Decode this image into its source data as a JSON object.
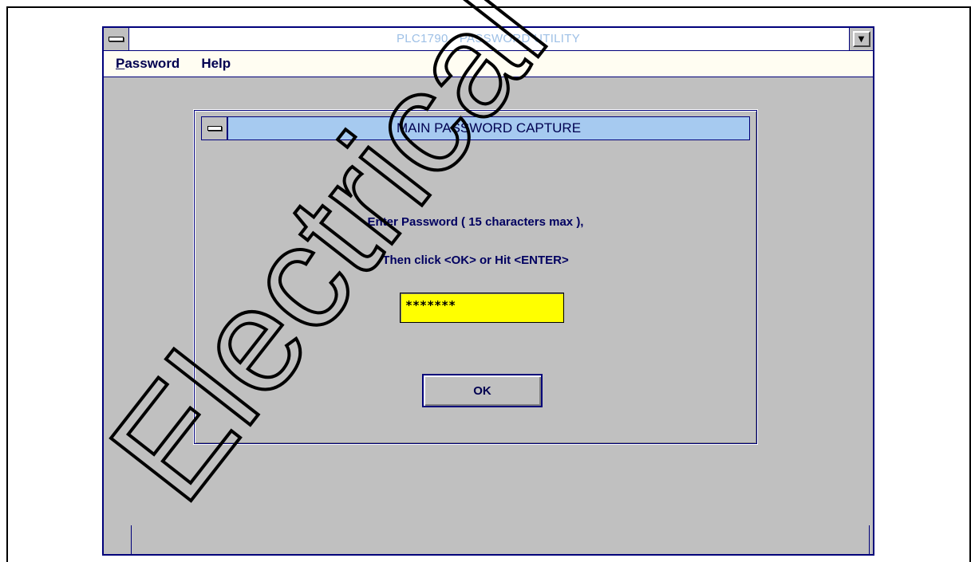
{
  "window": {
    "title": "PLC1790 - PASSWORD UTILITY"
  },
  "menu": {
    "items": [
      {
        "label": "assword",
        "accel": "P"
      },
      {
        "label": "Help",
        "accel": ""
      }
    ]
  },
  "dialog": {
    "title": "MAIN PASSWORD CAPTURE",
    "prompt_line1": "Enter Password ( 15 characters max ),",
    "prompt_line2": "Then click <OK> or Hit <ENTER>",
    "password_value": "*******",
    "ok_label": "OK"
  },
  "watermark": {
    "text": "Electrical"
  },
  "colors": {
    "app_title_text": "#9ec0e6",
    "dialog_titlebar": "#a6caf0",
    "password_field_bg": "#ffff00",
    "window_border": "#00007a",
    "client_bg": "#c0c0c0"
  }
}
